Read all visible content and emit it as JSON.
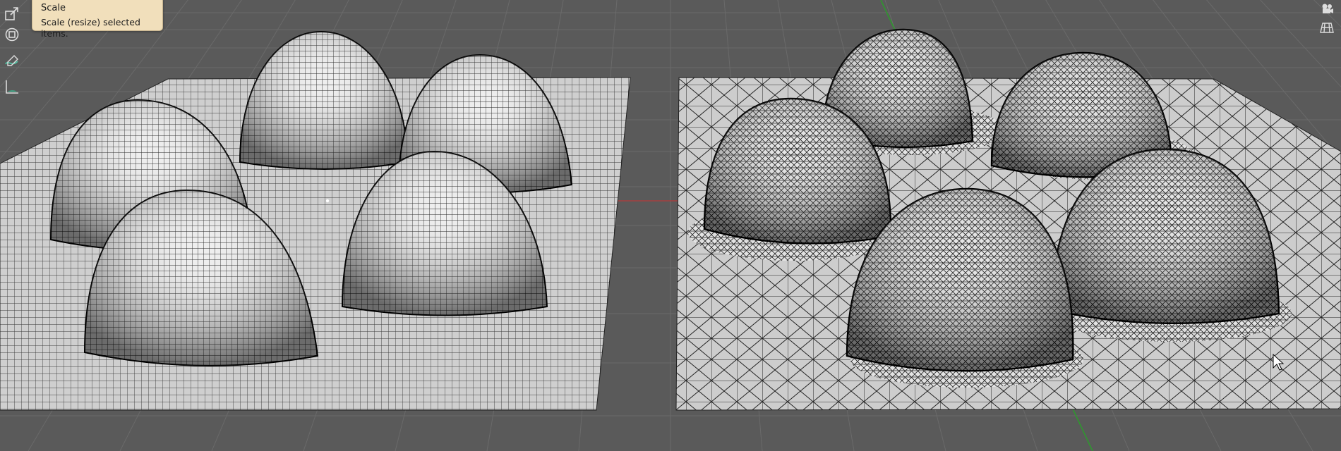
{
  "tooltip": {
    "title": "Scale",
    "description": "Scale (resize) selected items."
  },
  "toolbar": {
    "items": [
      {
        "name": "scale-tool",
        "icon": "scale-icon"
      },
      {
        "name": "transform-tool",
        "icon": "transform-icon"
      },
      {
        "name": "annotate-tool",
        "icon": "annotate-icon"
      },
      {
        "name": "measure-tool",
        "icon": "measure-icon"
      }
    ]
  },
  "navigation": {
    "items": [
      {
        "name": "camera-view",
        "icon": "camera-icon"
      },
      {
        "name": "toggle-ortho",
        "icon": "grid-icon"
      }
    ]
  },
  "colors": {
    "background": "#5a5a5a",
    "grid_line": "#6a6a6a",
    "mesh_face": "#cfcfcf",
    "wire": "#111111",
    "x_axis": "#b33a3a",
    "y_axis": "#2d9a2d",
    "tooltip_bg": "#f1dfbb"
  }
}
